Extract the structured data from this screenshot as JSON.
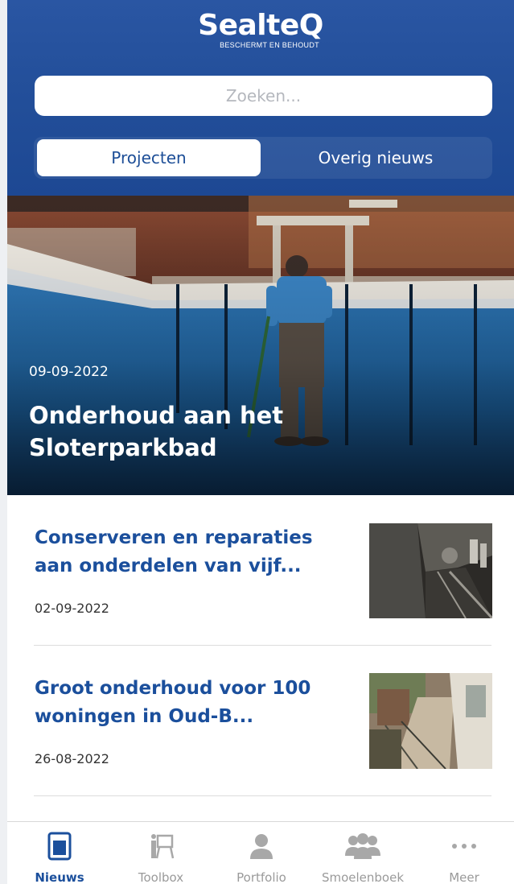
{
  "header": {
    "brand": "SealteQ",
    "tagline": "BESCHERMT EN BEHOUDT",
    "search_placeholder": "Zoeken...",
    "segments": [
      "Projecten",
      "Overig nieuws"
    ],
    "active_segment": "Projecten"
  },
  "hero": {
    "date": "09-09-2022",
    "title": "Onderhoud aan het Sloterparkbad"
  },
  "articles": [
    {
      "title": "Conserveren en reparaties aan onderdelen van vijf...",
      "date": "02-09-2022"
    },
    {
      "title": "Groot onderhoud voor 100 woningen in Oud-B...",
      "date": "26-08-2022"
    }
  ],
  "tabbar": {
    "tabs": [
      {
        "label": "Nieuws",
        "icon": "news-icon"
      },
      {
        "label": "Toolbox",
        "icon": "toolbox-icon"
      },
      {
        "label": "Portfolio",
        "icon": "person-icon"
      },
      {
        "label": "Smoelenboek",
        "icon": "people-icon"
      },
      {
        "label": "Meer",
        "icon": "more-icon"
      }
    ],
    "active": "Nieuws"
  },
  "colors": {
    "header_blue": "#234f9a",
    "title_blue": "#1b4f9c",
    "inactive_gray": "#9a9a9a"
  }
}
